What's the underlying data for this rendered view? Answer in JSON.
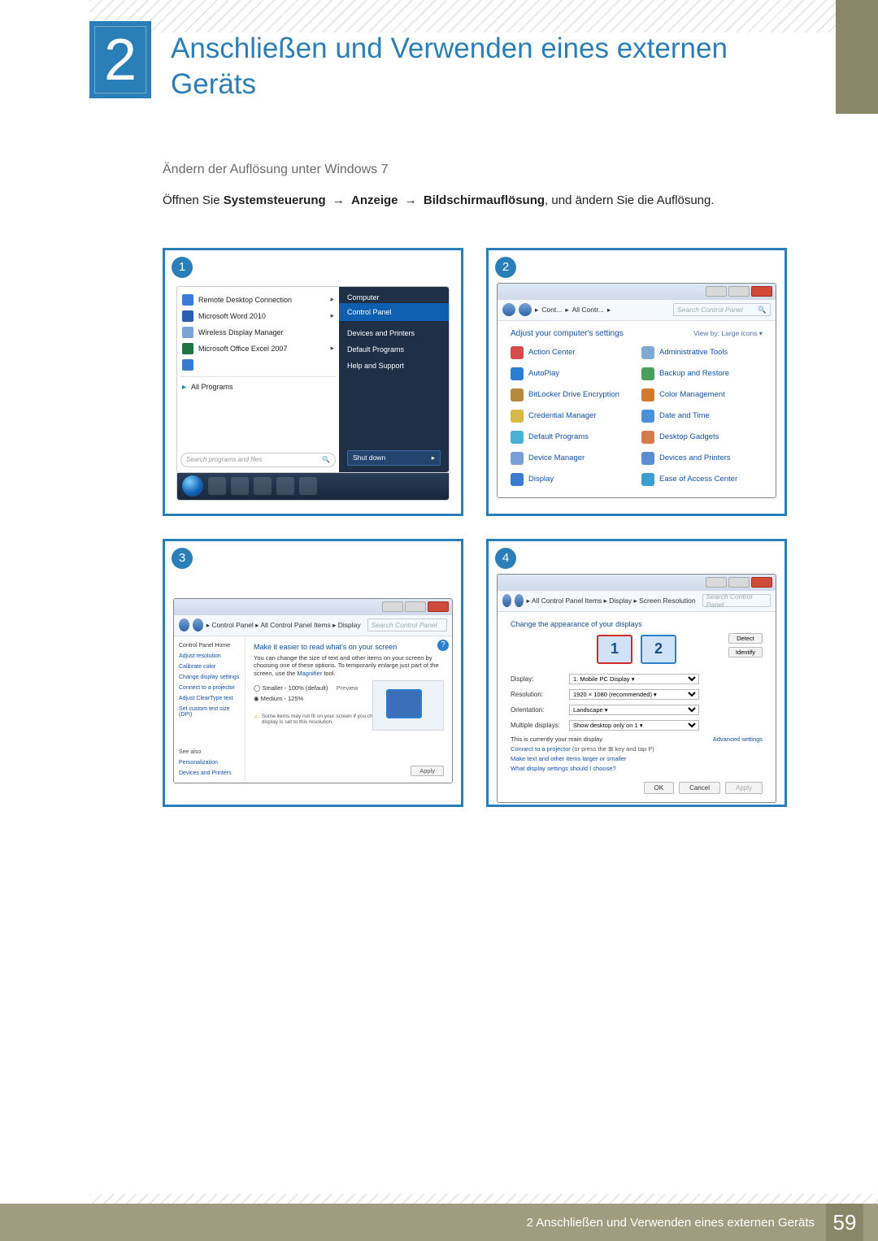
{
  "chapter": {
    "number": "2",
    "title": "Anschließen und Verwenden eines externen Geräts"
  },
  "section_heading": "Ändern der Auflösung unter Windows 7",
  "instruction": {
    "prefix": "Öffnen Sie ",
    "b1": "Systemsteuerung",
    "arrow": "→",
    "b2": "Anzeige",
    "b3": "Bildschirmauflösung",
    "suffix": ", und ändern Sie die Auflösung."
  },
  "footer": {
    "text": "2 Anschließen und Verwenden eines externen Geräts",
    "page": "59"
  },
  "shot1": {
    "badge": "1",
    "items": [
      "Remote Desktop Connection",
      "Microsoft Word 2010",
      "Wireless Display Manager",
      "Microsoft Office Excel 2007"
    ],
    "all_programs": "All Programs",
    "search_placeholder": "Search programs and files",
    "right": [
      "Computer",
      "Control Panel",
      "Devices and Printers",
      "Default Programs",
      "Help and Support"
    ],
    "shutdown": "Shut down"
  },
  "shot2": {
    "badge": "2",
    "breadcrumb": [
      "Cont...",
      "All Contr..."
    ],
    "search_placeholder": "Search Control Panel",
    "heading": "Adjust your computer's settings",
    "view_by": "View by:   Large icons ▾",
    "items": [
      {
        "label": "Action Center",
        "color": "#d64b4b"
      },
      {
        "label": "Administrative Tools",
        "color": "#7fa9d0"
      },
      {
        "label": "AutoPlay",
        "color": "#2a7fd0"
      },
      {
        "label": "Backup and Restore",
        "color": "#49a05a"
      },
      {
        "label": "BitLocker Drive Encryption",
        "color": "#b58a3e"
      },
      {
        "label": "Color Management",
        "color": "#d07a2a"
      },
      {
        "label": "Credential Manager",
        "color": "#d6b84b"
      },
      {
        "label": "Date and Time",
        "color": "#4b90d6"
      },
      {
        "label": "Default Programs",
        "color": "#4bb0d6"
      },
      {
        "label": "Desktop Gadgets",
        "color": "#d67a4b"
      },
      {
        "label": "Device Manager",
        "color": "#7a9ed6"
      },
      {
        "label": "Devices and Printers",
        "color": "#5a8ed0"
      },
      {
        "label": "Display",
        "color": "#3a7ad0"
      },
      {
        "label": "Ease of Access Center",
        "color": "#3a9ed0"
      }
    ]
  },
  "shot3": {
    "badge": "3",
    "breadcrumb": "▸ Control Panel ▸ All Control Panel Items ▸ Display",
    "search_placeholder": "Search Control Panel",
    "side_heading": "Control Panel Home",
    "side_links": [
      "Adjust resolution",
      "Calibrate color",
      "Change display settings",
      "Connect to a projector",
      "Adjust ClearType text",
      "Set custom text size (DPI)"
    ],
    "see_also": "See also",
    "see_also_links": [
      "Personalization",
      "Devices and Printers"
    ],
    "main_title": "Make it easier to read what's on your screen",
    "main_desc_1": "You can change the size of text and other items on your screen by choosing one of these options. To temporarily enlarge just part of the screen, use the ",
    "main_desc_link": "Magnifier",
    "main_desc_2": " tool.",
    "opt_small": "Smaller - 100% (default)",
    "preview_label": "Preview",
    "opt_medium": "Medium - 125%",
    "note": "Some items may not fit on your screen if you choose this setting while your display is set to this resolution.",
    "apply": "Apply"
  },
  "shot4": {
    "badge": "4",
    "breadcrumb": "▸ All Control Panel Items ▸ Display ▸ Screen Resolution",
    "search_placeholder": "Search Control Panel",
    "title": "Change the appearance of your displays",
    "detect": "Detect",
    "identify": "Identify",
    "labels": {
      "display": "Display:",
      "resolution": "Resolution:",
      "orientation": "Orientation:",
      "multiple": "Multiple displays:"
    },
    "values": {
      "display": "1. Mobile PC Display ▾",
      "resolution": "1920 × 1080 (recommended) ▾",
      "orientation": "Landscape ▾",
      "multiple": "Show desktop only on 1 ▾"
    },
    "main_display_msg": "This is currently your main display.",
    "advanced": "Advanced settings",
    "proj_link": "Connect to a projector",
    "proj_hint": " (or press the ⊞ key and tap P)",
    "larger_link": "Make text and other items larger or smaller",
    "what_link": "What display settings should I choose?",
    "ok": "OK",
    "cancel": "Cancel",
    "apply": "Apply"
  }
}
